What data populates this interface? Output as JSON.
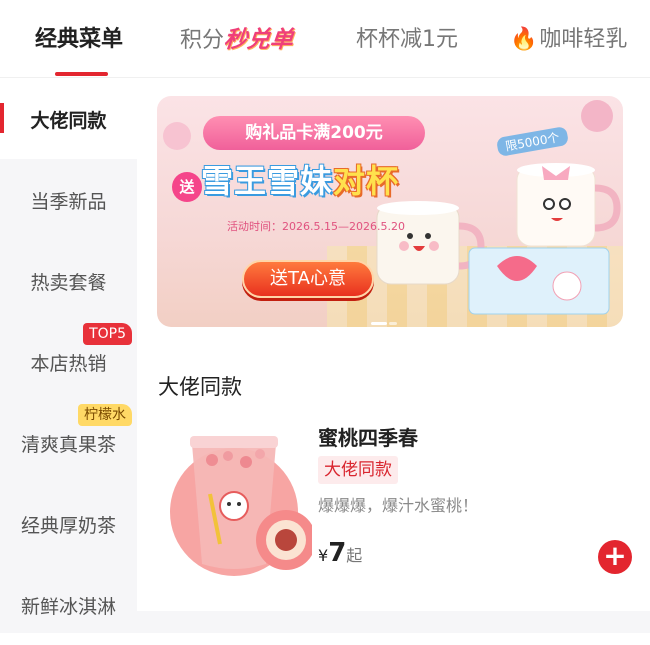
{
  "tabs": [
    {
      "label": "经典菜单",
      "active": true
    },
    {
      "label_prefix": "积分",
      "label_highlight": "秒兑单",
      "active": false
    },
    {
      "label": "杯杯减1元",
      "active": false
    },
    {
      "icon": "flame-icon",
      "label": "咖啡轻乳",
      "active": false
    }
  ],
  "sidebar": {
    "items": [
      {
        "label": "大佬同款",
        "active": true
      },
      {
        "label": "当季新品"
      },
      {
        "label": "热卖套餐"
      },
      {
        "label": "本店热销",
        "badge": "TOP5"
      },
      {
        "label": "清爽真果茶",
        "badge": "柠檬水"
      },
      {
        "label": "经典厚奶茶"
      },
      {
        "label": "新鲜冰淇淋"
      }
    ]
  },
  "banner": {
    "top_line": "购礼品卡满200元",
    "send_label": "送",
    "title_part1": "雪王雪妹",
    "title_part2": "对杯",
    "date": "活动时间：2026.5.15—2026.5.20",
    "limit_badge": "限5000个",
    "button_label": "送TA心意"
  },
  "section": {
    "title": "大佬同款"
  },
  "product": {
    "name": "蜜桃四季春",
    "tag": "大佬同款",
    "description": "爆爆爆，爆汁水蜜桃！",
    "currency": "¥",
    "price": "7",
    "price_suffix": "起",
    "add_label": "+"
  },
  "colors": {
    "accent": "#e3262f",
    "sidebar_bg": "#f6f6f8",
    "tag_bg": "#fdebec",
    "badge_yellow": "#ffd966"
  }
}
